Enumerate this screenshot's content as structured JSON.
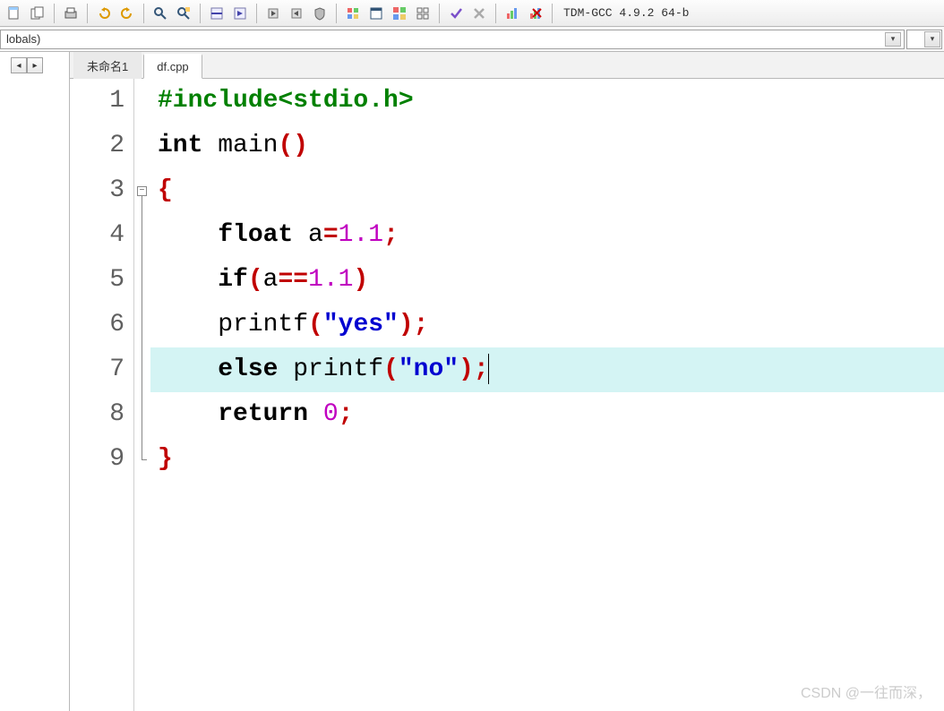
{
  "toolbar": {
    "compiler": "TDM-GCC 4.9.2 64-b"
  },
  "globals": {
    "label": "lobals)"
  },
  "tabs": [
    {
      "label": "未命名1",
      "active": false
    },
    {
      "label": "df.cpp",
      "active": true
    }
  ],
  "code": {
    "highlighted_line": 7,
    "lines": [
      {
        "n": 1,
        "tokens": [
          {
            "t": "#include<stdio.h>",
            "c": "pre"
          }
        ]
      },
      {
        "n": 2,
        "tokens": [
          {
            "t": "int",
            "c": "kw"
          },
          {
            "t": " main",
            "c": "fn"
          },
          {
            "t": "()",
            "c": "op"
          }
        ]
      },
      {
        "n": 3,
        "fold": "start",
        "tokens": [
          {
            "t": "{",
            "c": "brace"
          }
        ]
      },
      {
        "n": 4,
        "tokens": [
          {
            "t": "    ",
            "c": ""
          },
          {
            "t": "float",
            "c": "kw"
          },
          {
            "t": " a",
            "c": "fn"
          },
          {
            "t": "=",
            "c": "op"
          },
          {
            "t": "1.1",
            "c": "num"
          },
          {
            "t": ";",
            "c": "op"
          }
        ]
      },
      {
        "n": 5,
        "tokens": [
          {
            "t": "    ",
            "c": ""
          },
          {
            "t": "if",
            "c": "kw"
          },
          {
            "t": "(",
            "c": "op"
          },
          {
            "t": "a",
            "c": "fn"
          },
          {
            "t": "==",
            "c": "op"
          },
          {
            "t": "1.1",
            "c": "num"
          },
          {
            "t": ")",
            "c": "op"
          }
        ]
      },
      {
        "n": 6,
        "tokens": [
          {
            "t": "    printf",
            "c": "fn"
          },
          {
            "t": "(",
            "c": "op"
          },
          {
            "t": "\"yes\"",
            "c": "str"
          },
          {
            "t": ");",
            "c": "op"
          }
        ]
      },
      {
        "n": 7,
        "tokens": [
          {
            "t": "    ",
            "c": ""
          },
          {
            "t": "else",
            "c": "kw"
          },
          {
            "t": " printf",
            "c": "fn"
          },
          {
            "t": "(",
            "c": "op"
          },
          {
            "t": "\"no\"",
            "c": "str"
          },
          {
            "t": ");",
            "c": "op"
          }
        ],
        "caret": true
      },
      {
        "n": 8,
        "tokens": [
          {
            "t": "    ",
            "c": ""
          },
          {
            "t": "return",
            "c": "kw"
          },
          {
            "t": " ",
            "c": ""
          },
          {
            "t": "0",
            "c": "num"
          },
          {
            "t": ";",
            "c": "op"
          }
        ]
      },
      {
        "n": 9,
        "fold": "end",
        "tokens": [
          {
            "t": "}",
            "c": "brace"
          }
        ]
      }
    ]
  },
  "watermark": "CSDN @一往而深，"
}
